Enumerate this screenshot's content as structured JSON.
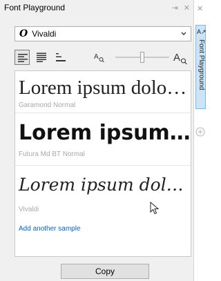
{
  "panel": {
    "title": "Font Playground",
    "title_icons": [
      "pin-icon",
      "close-icon"
    ]
  },
  "font_selector": {
    "value": "Vivaldi",
    "icon": "opentype-o-icon"
  },
  "toolbar": {
    "buttons": [
      "single-line-view-icon",
      "multi-line-view-icon",
      "waterfall-view-icon"
    ],
    "active_button": "single-line-view",
    "zoom_out_icon": "small-a-zoom-icon",
    "zoom_in_icon": "large-a-zoom-icon",
    "slider_level": 0.5
  },
  "samples": [
    {
      "text": "Lorem ipsum dolor sit amet",
      "caption": "Garamond Normal"
    },
    {
      "text": "Lorem ipsum dolor sit amet",
      "caption": "Futura Md BT Normal"
    },
    {
      "text": "Lorem ipsum dolor sit amet",
      "caption": "Vivaldi"
    }
  ],
  "add_sample_label": "Add another sample",
  "copy_label": "Copy",
  "docker_tab": {
    "label": "Font Playground",
    "icon": "font-playground-tab-icon"
  }
}
